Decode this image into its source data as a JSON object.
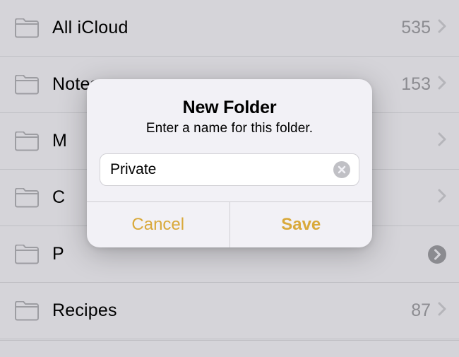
{
  "folders": [
    {
      "label": "All iCloud",
      "count": "535",
      "active": false
    },
    {
      "label": "Notes",
      "count": "153",
      "active": false
    },
    {
      "label": "M",
      "count": "",
      "active": false
    },
    {
      "label": "C",
      "count": "",
      "active": false
    },
    {
      "label": "P",
      "count": "",
      "active": true
    },
    {
      "label": "Recipes",
      "count": "87",
      "active": false
    }
  ],
  "modal": {
    "title": "New Folder",
    "subtitle": "Enter a name for this folder.",
    "input_value": "Private",
    "cancel_label": "Cancel",
    "save_label": "Save"
  }
}
